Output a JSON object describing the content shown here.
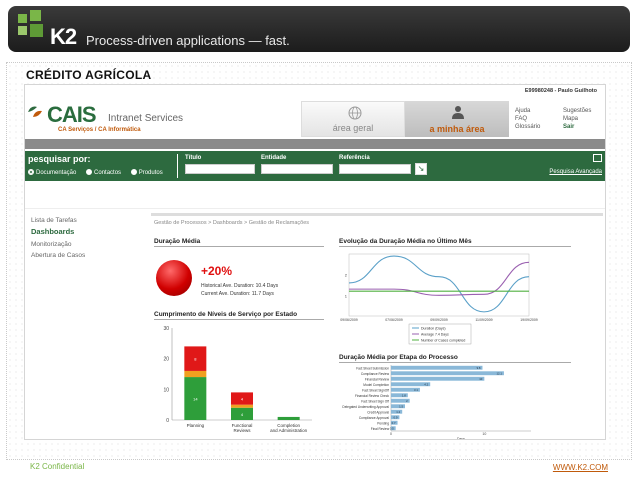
{
  "banner": {
    "logo": "K2",
    "tagline": "Process-driven applications — fast."
  },
  "slide_title": "CRÉDITO AGRÍCOLA",
  "app": {
    "user_line": "E99980248 - Paulo Guilhoto",
    "brand": "CAIS",
    "brand_sub": "Intranet Services",
    "brand_org": "CA Serviços / CA Informática",
    "area_geral": "área geral",
    "area_minha": "a minha área",
    "links_1": [
      "Ajuda",
      "FAQ",
      "Glossário"
    ],
    "links_2": [
      "Sugestões",
      "Mapa",
      "Sair"
    ],
    "brand_color": "#2d6a3f",
    "accent_color": "#c05a0b"
  },
  "search": {
    "title": "pesquisar por:",
    "options": [
      "Documentação",
      "Contactos",
      "Produtos"
    ],
    "fields": [
      "Título",
      "Entidade",
      "Referência"
    ],
    "advanced": "Pesquisa Avançada"
  },
  "nav": {
    "items": [
      "Lista de Tarefas",
      "Dashboards",
      "Monitorização",
      "Abertura de Casos"
    ],
    "active": "Dashboards"
  },
  "breadcrumb": "Gestão de Processos > Dashboards > Gestão de Reclamações",
  "panels": {
    "duracao_media": {
      "title": "Duração Média",
      "change": "+20%",
      "historical": "Historical Ave. Duration: 10.4 Days",
      "current": "Current Ave. Duration: 11.7 Days"
    },
    "evolucao": {
      "title": "Evolução da Duração Média no Último Mês"
    },
    "niveis": {
      "title": "Cumprimento de Níveis de Serviço por Estado"
    },
    "etapa": {
      "title": "Duração Média por Etapa do Processo"
    }
  },
  "chart_data": [
    {
      "type": "bar",
      "title": "Cumprimento de Níveis de Serviço por Estado",
      "categories": [
        "Planning",
        "Functional Reviews",
        "Completion and Administration"
      ],
      "ylim": [
        0,
        30
      ],
      "yticks": [
        0,
        10,
        20,
        30
      ],
      "series": [
        {
          "color": "#2e9e3a",
          "values": [
            14,
            4,
            1
          ]
        },
        {
          "color": "#f0a020",
          "values": [
            2,
            1,
            0
          ]
        },
        {
          "color": "#e01818",
          "values": [
            8,
            4,
            0
          ]
        }
      ]
    },
    {
      "type": "line",
      "title": "Evolução da Duração Média no Último Mês",
      "x": [
        "09/06/2009",
        "07/06/2009",
        "09/09/2009",
        "11/09/2009",
        "19/09/2009"
      ],
      "ylim": [
        0,
        3
      ],
      "series": [
        {
          "name": "Duration (Days)",
          "color": "#5aa0c8",
          "values": [
            1.6,
            2.9,
            1.9,
            0.2,
            1.9
          ]
        },
        {
          "name": "Average 7.4 Days",
          "color": "#9a60b0",
          "values": [
            1.3,
            1.3,
            1.0,
            1.05,
            2.6
          ]
        },
        {
          "name": "Number of Cases completed",
          "color": "#50b040",
          "values": [
            1.2,
            1.2,
            1.2,
            1.2,
            1.2
          ]
        }
      ]
    },
    {
      "type": "bar",
      "orientation": "horizontal",
      "title": "Duração Média por Etapa do Processo",
      "categories": [
        "Fact Sheet Submission",
        "Compliance Review",
        "Financial Review",
        "Model Completion",
        "Fact Sheet SignOff",
        "Financial Review Check",
        "Fact Sheet Sign Off",
        "Delegated Underwriting Approval",
        "Credit Approval",
        "Compliance Approval",
        "Pending",
        "Final Review"
      ],
      "values": [
        9.8,
        12.1,
        10.0,
        4.2,
        3.1,
        1.8,
        2.0,
        1.5,
        1.2,
        0.9,
        0.7,
        0.5
      ],
      "xlim": [
        0,
        15
      ],
      "xlabel": "Days",
      "color": "#8ab8d8"
    }
  ],
  "footer": {
    "left": "K2 Confidential",
    "right": "WWW.K2.COM"
  }
}
